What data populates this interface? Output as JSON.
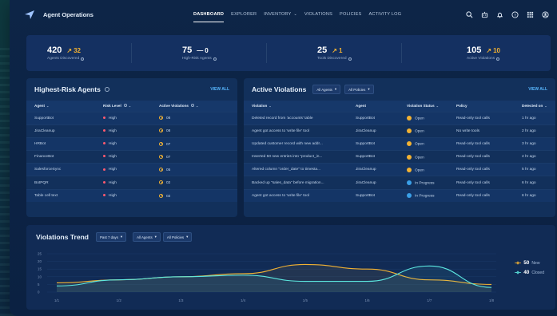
{
  "header": {
    "app_title": "Agent Operations",
    "nav": [
      {
        "label": "DASHBOARD",
        "active": true,
        "caret": false
      },
      {
        "label": "EXPLORER",
        "active": false,
        "caret": false
      },
      {
        "label": "INVENTORY",
        "active": false,
        "caret": true
      },
      {
        "label": "VIOLATIONS",
        "active": false,
        "caret": false
      },
      {
        "label": "POLICIES",
        "active": false,
        "caret": false
      },
      {
        "label": "ACTIVITY LOG",
        "active": false,
        "caret": false
      }
    ],
    "icons": [
      "search-icon",
      "robot-icon",
      "bell-icon",
      "help-icon",
      "apps-grid-icon",
      "user-icon"
    ]
  },
  "kpis": [
    {
      "value": "420",
      "delta": "32",
      "delta_trend": "up",
      "label": "Agents Discovered"
    },
    {
      "value": "75",
      "delta": "0",
      "delta_trend": "flat",
      "label": "High-Risk Agents"
    },
    {
      "value": "25",
      "delta": "1",
      "delta_trend": "up",
      "label": "Tools Discovered"
    },
    {
      "value": "105",
      "delta": "10",
      "delta_trend": "up",
      "label": "Active Violations"
    }
  ],
  "risk_panel": {
    "title": "Highest-Risk Agents",
    "view_all": "VIEW ALL",
    "columns": [
      "Agent",
      "Risk Level",
      "Active Violations"
    ],
    "rows": [
      {
        "agent": "SupportBot",
        "risk": "High",
        "violations": "08"
      },
      {
        "agent": "JiraCleanup",
        "risk": "High",
        "violations": "08"
      },
      {
        "agent": "HRBot",
        "risk": "High",
        "violations": "07"
      },
      {
        "agent": "FinanceBot",
        "risk": "High",
        "violations": "07"
      },
      {
        "agent": "SalesforceSync",
        "risk": "High",
        "violations": "05"
      },
      {
        "agent": "BotPQR",
        "risk": "High",
        "violations": "02"
      },
      {
        "agent": "Table cell text",
        "risk": "High",
        "violations": "02"
      }
    ]
  },
  "violations_panel": {
    "title": "Active Violations",
    "filter_agents": "All Agents",
    "filter_policies": "All Policies",
    "view_all": "VIEW ALL",
    "columns": [
      "Violation",
      "Agent",
      "Violation Status",
      "Policy",
      "Detected on"
    ],
    "rows": [
      {
        "violation": "Deleted record from 'accounts' table",
        "agent": "SupportBot",
        "status": "Open",
        "policy": "Read-only tool calls",
        "detected": "1 hr ago"
      },
      {
        "violation": "Agent got access to 'write file' tool",
        "agent": "JiraCleanup",
        "status": "Open",
        "policy": "No write tools",
        "detected": "2 hr ago"
      },
      {
        "violation": "Updated customer record with new addr...",
        "agent": "SupportBot",
        "status": "Open",
        "policy": "Read-only tool calls",
        "detected": "3 hr ago"
      },
      {
        "violation": "Inserted 50 new entries into \"product_in...",
        "agent": "SupportBot",
        "status": "Open",
        "policy": "Read-only tool calls",
        "detected": "4 hr ago"
      },
      {
        "violation": "Altered column \"order_date\" to timesta...",
        "agent": "JiraCleanup",
        "status": "Open",
        "policy": "Read-only tool calls",
        "detected": "5 hr ago"
      },
      {
        "violation": "Backed up \"sales_data\" before migration...",
        "agent": "JiraCleanup",
        "status": "In Progress",
        "policy": "Read-only tool calls",
        "detected": "6 hr ago"
      },
      {
        "violation": "Agent got access to 'write file' tool",
        "agent": "SupportBot",
        "status": "In Progress",
        "policy": "Read-only tool calls",
        "detected": "6 hr ago"
      }
    ]
  },
  "trend": {
    "title": "Violations Trend",
    "filter_period": "Past 7 days",
    "filter_agents": "All Agents",
    "filter_policies": "All Policies",
    "legend": [
      {
        "count": "50",
        "label": "New",
        "color": "#f2b233"
      },
      {
        "count": "40",
        "label": "Closed",
        "color": "#5ce8e0"
      }
    ]
  },
  "chart_data": {
    "type": "line",
    "x": [
      "1/1",
      "1/2",
      "1/3",
      "1/4",
      "1/5",
      "1/6",
      "1/7",
      "1/8"
    ],
    "ylim": [
      0,
      25
    ],
    "yticks": [
      "0",
      "5",
      "10",
      "15",
      "20",
      "25"
    ],
    "series": [
      {
        "name": "New",
        "color": "#f2b233",
        "values": [
          6,
          8,
          10,
          12,
          18,
          15,
          8,
          5
        ]
      },
      {
        "name": "Closed",
        "color": "#5ce8e0",
        "values": [
          4,
          8,
          10,
          11,
          7,
          7,
          17,
          3
        ]
      }
    ]
  }
}
